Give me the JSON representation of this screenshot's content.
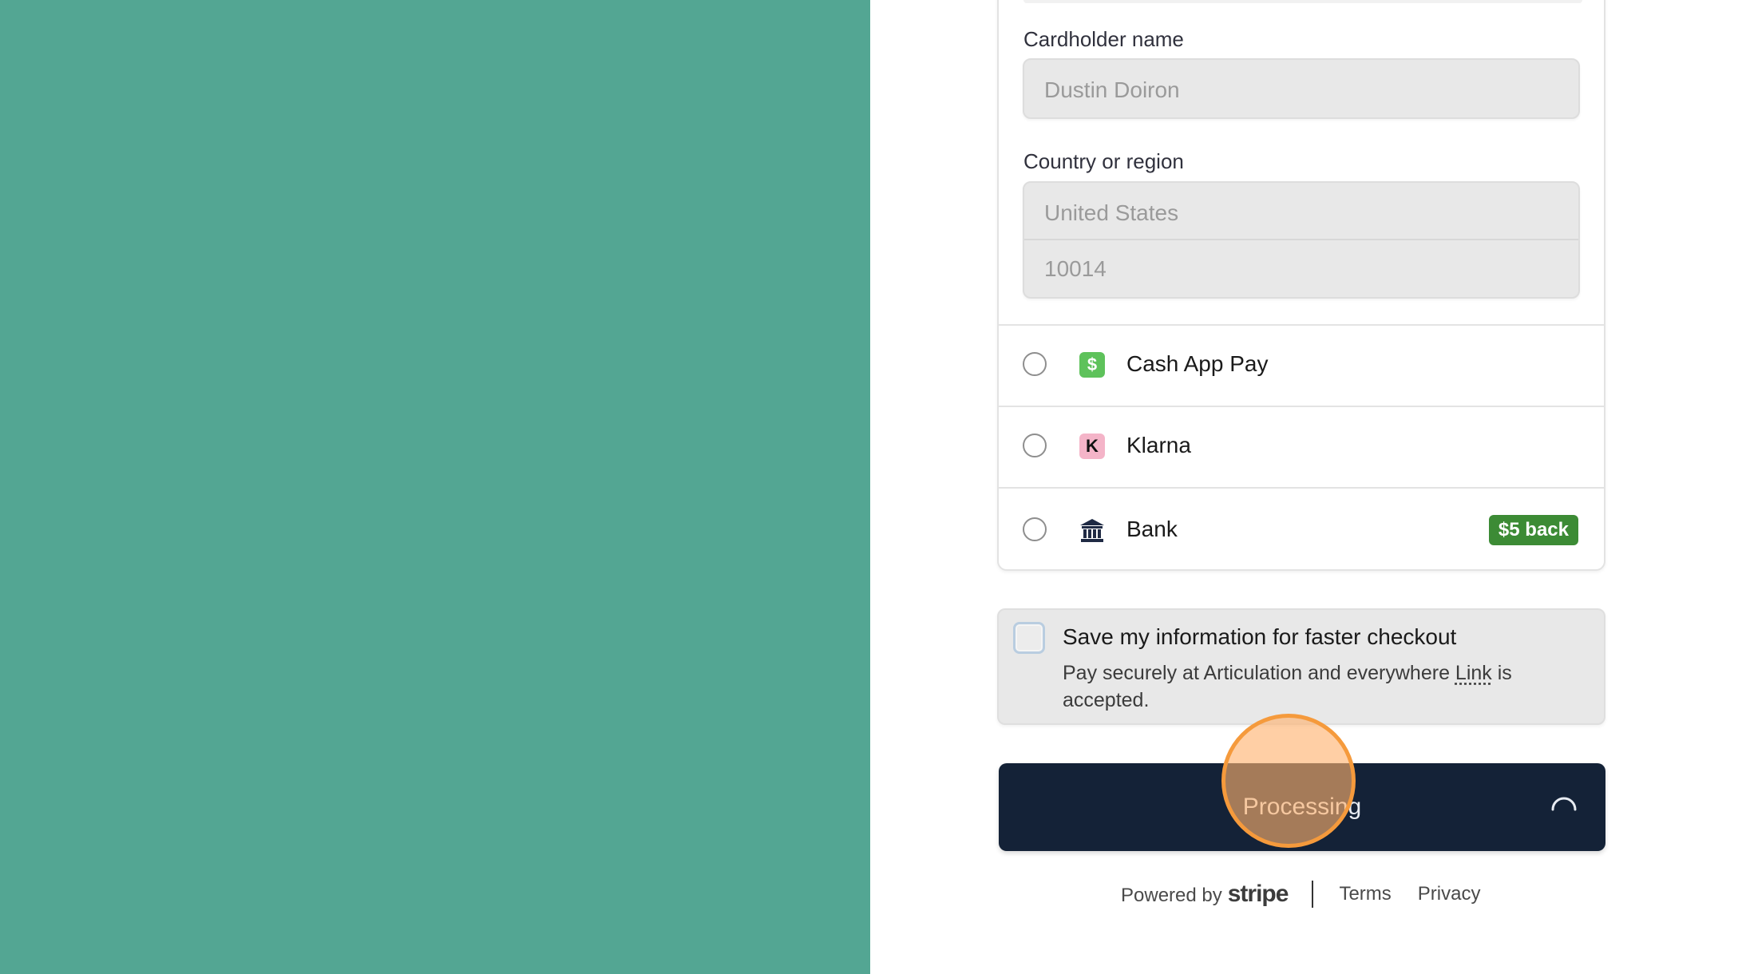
{
  "form": {
    "cardholder_label": "Cardholder name",
    "cardholder_value": "Dustin Doiron",
    "country_label": "Country or region",
    "country_value": "United States",
    "zip_value": "10014"
  },
  "payment_methods": [
    {
      "label": "Cash App Pay",
      "icon": "cash-app-icon",
      "icon_glyph": "$",
      "icon_color": "#5ec25b"
    },
    {
      "label": "Klarna",
      "icon": "klarna-icon",
      "icon_glyph": "K",
      "icon_color": "#f4b4c8"
    },
    {
      "label": "Bank",
      "icon": "bank-icon",
      "badge": "$5 back",
      "badge_color": "#3c8b35"
    }
  ],
  "save_info": {
    "title": "Save my information for faster checkout",
    "desc_prefix": "Pay securely at Articulation and everywhere ",
    "link": "Link",
    "desc_suffix": " is accepted."
  },
  "pay_button": {
    "label": "Processing",
    "color": "#142237"
  },
  "footer": {
    "powered_by": "Powered by",
    "brand": "stripe",
    "terms": "Terms",
    "privacy": "Privacy"
  },
  "colors": {
    "left_panel": "#53a693",
    "click_indicator": "#f59a3c"
  }
}
